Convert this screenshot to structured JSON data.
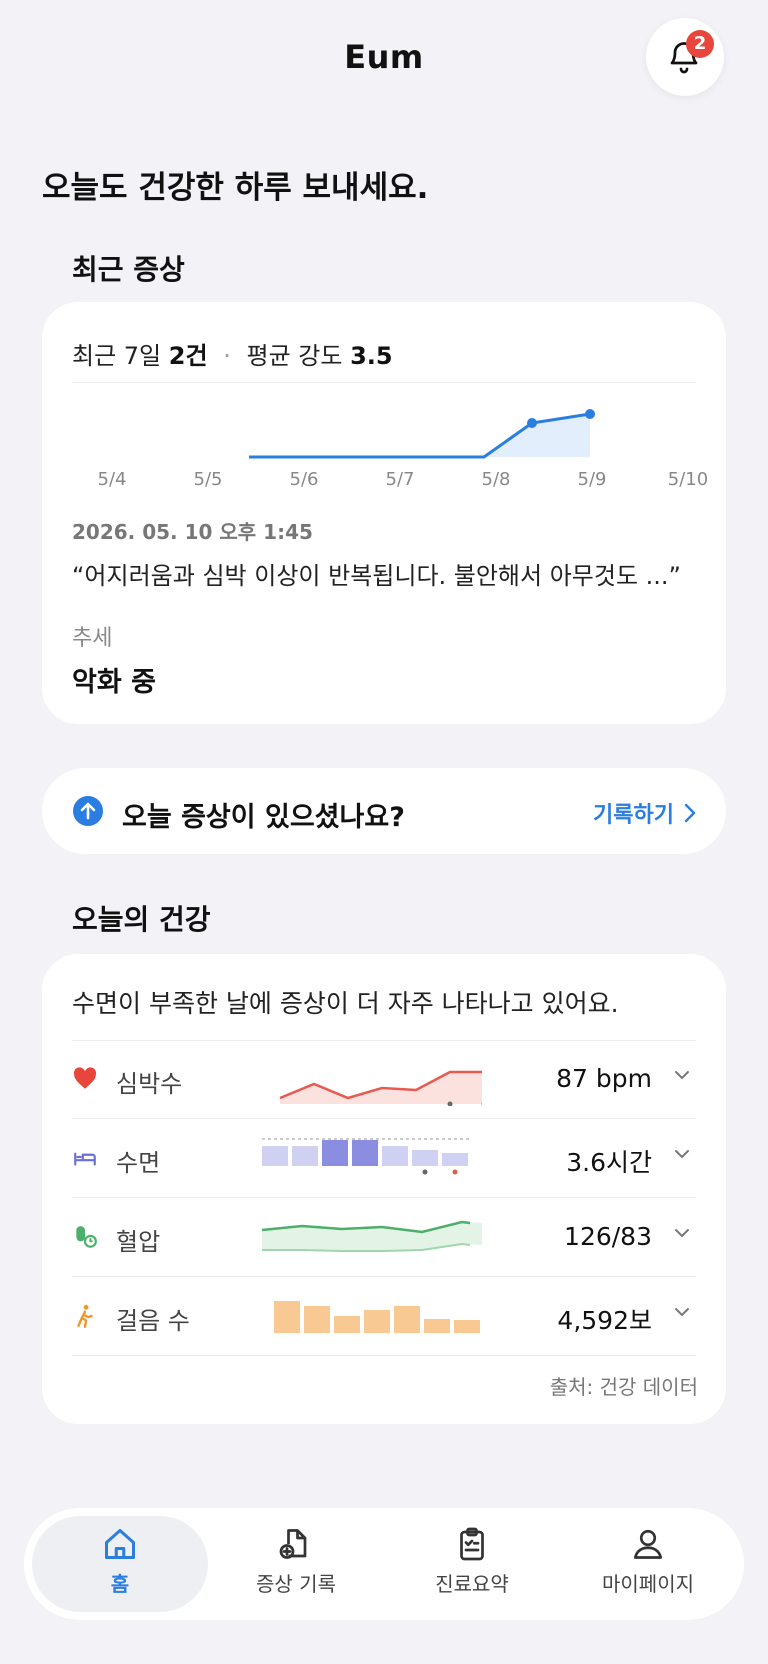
{
  "header": {
    "title": "Eum",
    "notification_count": "2"
  },
  "greeting": "오늘도 건강한 하루 보내세요.",
  "recent_symptoms": {
    "section_title": "최근 증상",
    "summary_prefix": "최근 7일",
    "summary_count": "2건",
    "summary_mid": "평균 강도",
    "summary_avg": "3.5",
    "chart_data": {
      "type": "line",
      "categories": [
        "5/4",
        "5/5",
        "5/6",
        "5/7",
        "5/8",
        "5/9",
        "5/10"
      ]
    },
    "latest_time": "2026. 05. 10 오후 1:45",
    "latest_quote": "“어지러움과 심박 이상이 반복됩니다. 불안해서 아무것도 ...”",
    "trend_label": "추세",
    "trend_value": "악화 중"
  },
  "record_prompt": {
    "question": "오늘 증상이 있으셨나요?",
    "action_label": "기록하기"
  },
  "today_health": {
    "section_title": "오늘의 건강",
    "insight": "수면이 부족한 날에 증상이 더 자주 나타나고 있어요.",
    "metrics": [
      {
        "label": "심박수",
        "value": "87 bpm",
        "icon": "heart-icon",
        "color": "#e85a4f"
      },
      {
        "label": "수면",
        "value": "3.6시간",
        "icon": "bed-icon",
        "color": "#6b6fd6"
      },
      {
        "label": "혈압",
        "value": "126/83",
        "icon": "blood-pressure-icon",
        "color": "#4caf6a"
      },
      {
        "label": "걸음 수",
        "value": "4,592보",
        "icon": "walk-icon",
        "color": "#f0962e"
      }
    ],
    "source": "출처: 건강 데이터"
  },
  "tabs": [
    {
      "label": "홈",
      "icon": "home-icon",
      "active": true
    },
    {
      "label": "증상 기록",
      "icon": "add-document-icon",
      "active": false
    },
    {
      "label": "진료요약",
      "icon": "clipboard-icon",
      "active": false
    },
    {
      "label": "마이페이지",
      "icon": "person-icon",
      "active": false
    }
  ],
  "colors": {
    "accent": "#2a7de1",
    "badge": "#e8453c",
    "background": "#f2f2f7"
  }
}
